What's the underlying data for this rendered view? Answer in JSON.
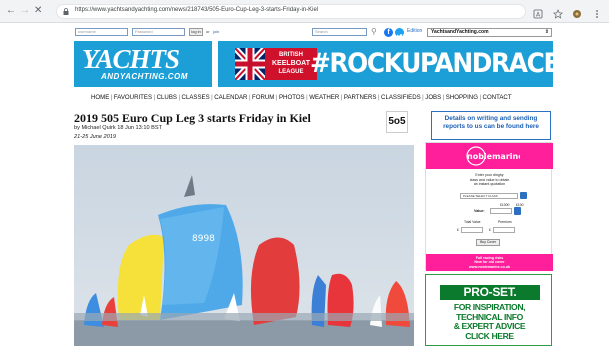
{
  "browser": {
    "back_icon": "back-arrow-icon",
    "forward_icon": "forward-arrow-icon",
    "reload_icon": "reload-icon",
    "url": "https://www.yachtsandyachting.com/news/218743/505-Euro-Cup-Leg-3-starts-Friday-in-Kiel"
  },
  "topbar": {
    "username_placeholder": "username",
    "password_placeholder": "Password",
    "login_label": "log in",
    "or_label": "or",
    "join_label": "join",
    "search_placeholder": "Search",
    "edition_label": "Edition",
    "edition_value": "YachtsandYachting.com",
    "colors": {
      "facebook": "#1877f2",
      "twitter": "#1da1f2"
    }
  },
  "logo": {
    "main": "YACHTS",
    "sub": "ANDYACHTING.COM"
  },
  "banner": {
    "league_line1": "BRITISH",
    "league_line2": "KEELBOAT",
    "league_line3": "LEAGUE",
    "hashtag": "#ROCKUPANDRACE",
    "colors": {
      "background": "#1c9fd6",
      "accent": "#d0112b"
    }
  },
  "nav": [
    "HOME",
    "FAVOURITES",
    "CLUBS",
    "CLASSES",
    "CALENDAR",
    "FORUM",
    "PHOTOS",
    "WEATHER",
    "PARTNERS",
    "CLASSIFIEDS",
    "JOBS",
    "SHOPPING",
    "CONTACT"
  ],
  "article": {
    "title": "2019 505 Euro Cup Leg 3 starts Friday in Kiel",
    "byline": "by Michael Quirk 18 Jun 13:10 BST",
    "dates": "21-25 June 2019",
    "class_logo": "5o5",
    "photo_sail_number": "8998"
  },
  "sidebar": {
    "info_line1": "Details on writing and sending",
    "info_line2": "reports to us can be found here",
    "ad": {
      "brand": "noblemarine",
      "text_lines": [
        "Enter your dinghy",
        "class and value to obtain",
        "an instant quotation"
      ],
      "class_select": "PLEASE SELECT CLASS",
      "value_label": "Value:",
      "value_from": "£1000",
      "value_to": "£100",
      "total_value_label": "Total Value",
      "premium_label": "Premium",
      "currency": "£",
      "buy_cover_label": "Buy Cover",
      "footer_line1": "Full racing risks",
      "footer_line2": "New for old cover",
      "footer_line3": "www.noblemarine.co.uk",
      "colors": {
        "brand": "#ff1f9a"
      }
    },
    "proset": {
      "logo": "PRO-SET.",
      "line1": "FOR INSPIRATION,",
      "line2": "TECHNICAL INFO",
      "line3": "& EXPERT ADVICE",
      "line4": "CLICK HERE",
      "colors": {
        "brand": "#0c7a2c"
      }
    }
  }
}
